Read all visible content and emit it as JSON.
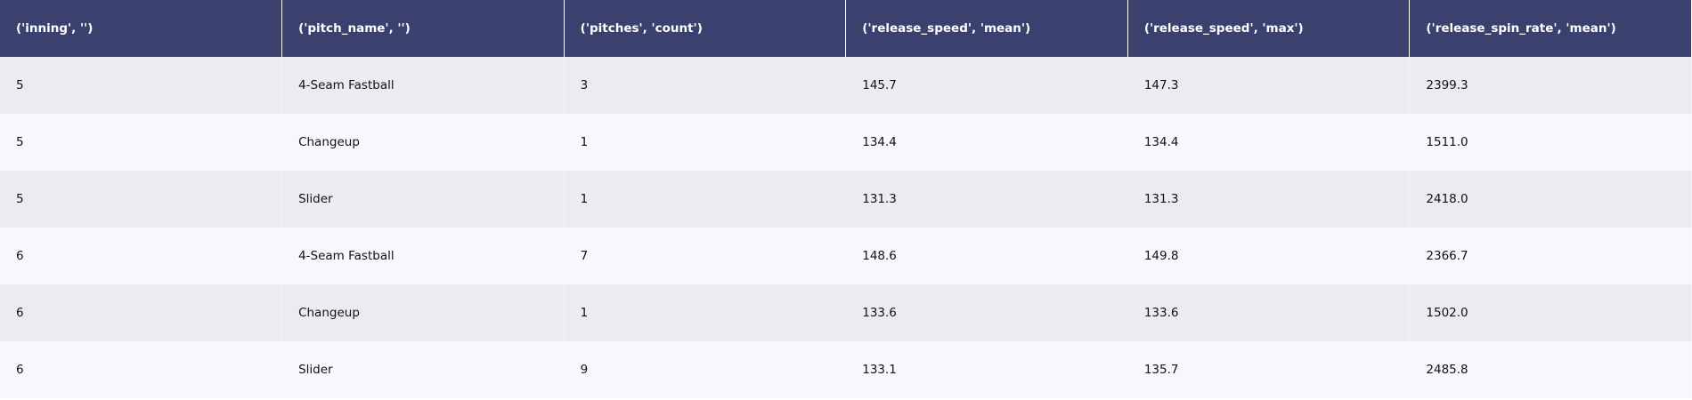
{
  "table": {
    "columns": [
      "('inning', '')",
      "('pitch_name', '')",
      "('pitches', 'count')",
      "('release_speed', 'mean')",
      "('release_speed', 'max')",
      "('release_spin_rate', 'mean')"
    ],
    "rows": [
      [
        "5",
        "4-Seam Fastball",
        "3",
        "145.7",
        "147.3",
        "2399.3"
      ],
      [
        "5",
        "Changeup",
        "1",
        "134.4",
        "134.4",
        "1511.0"
      ],
      [
        "5",
        "Slider",
        "1",
        "131.3",
        "131.3",
        "2418.0"
      ],
      [
        "6",
        "4-Seam Fastball",
        "7",
        "148.6",
        "149.8",
        "2366.7"
      ],
      [
        "6",
        "Changeup",
        "1",
        "133.6",
        "133.6",
        "1502.0"
      ],
      [
        "6",
        "Slider",
        "9",
        "133.1",
        "135.7",
        "2485.8"
      ]
    ]
  },
  "colors": {
    "header_bg": "#3a416e",
    "row_odd_bg": "#ebecef",
    "row_even_bg": "#f7f8fc"
  }
}
